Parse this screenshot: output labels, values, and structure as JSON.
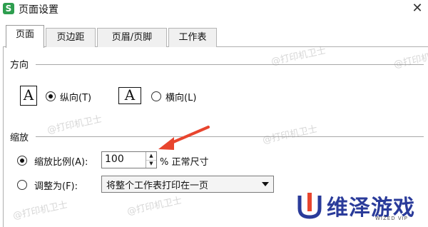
{
  "window": {
    "app_icon": "S",
    "title": "页面设置",
    "close": "✕"
  },
  "tabs": [
    {
      "label": "页面",
      "active": true
    },
    {
      "label": "页边距",
      "active": false
    },
    {
      "label": "页眉/页脚",
      "active": false
    },
    {
      "label": "工作表",
      "active": false
    }
  ],
  "orientation": {
    "section_label": "方向",
    "portrait_icon": "A",
    "portrait_label": "纵向(T)",
    "landscape_icon": "A",
    "landscape_label": "横向(L)",
    "selected": "portrait"
  },
  "scaling": {
    "section_label": "缩放",
    "scale_label": "缩放比例(A):",
    "scale_value": "100",
    "scale_unit": "% 正常尺寸",
    "fit_label": "调整为(F):",
    "fit_option": "将整个工作表打印在一页",
    "selected": "scale"
  },
  "watermark": {
    "text": "@打印机卫士"
  },
  "logo": {
    "text": "维泽游戏",
    "sub": "WIZED VIP"
  },
  "colors": {
    "accent": "#1a5fd0",
    "arrow": "#e8452e",
    "logo": "#2a3b9a"
  }
}
